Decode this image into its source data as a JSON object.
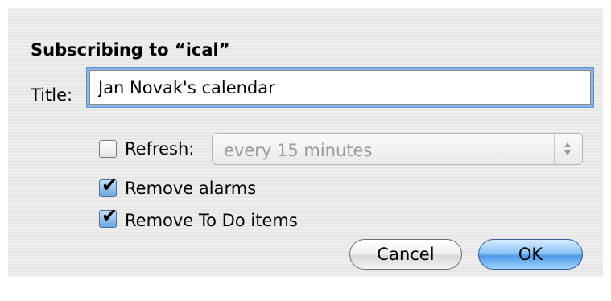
{
  "dialog": {
    "heading": "Subscribing to “ical”",
    "title_label": "Title:",
    "title_value": "Jan Novak's calendar",
    "refresh": {
      "checked": false,
      "label": "Refresh:",
      "selected_option": "every 15 minutes",
      "enabled": false
    },
    "remove_alarms": {
      "checked": true,
      "label": "Remove alarms"
    },
    "remove_todo": {
      "checked": true,
      "label": "Remove To Do items"
    },
    "buttons": {
      "cancel": "Cancel",
      "ok": "OK"
    }
  },
  "colors": {
    "background": "#ebebeb",
    "focus_ring": "#8cb6e9",
    "default_button": "#4f9ae6",
    "disabled_text": "#9a9a9a"
  },
  "icons": [
    "checkmark-icon",
    "popup-arrows-icon"
  ]
}
